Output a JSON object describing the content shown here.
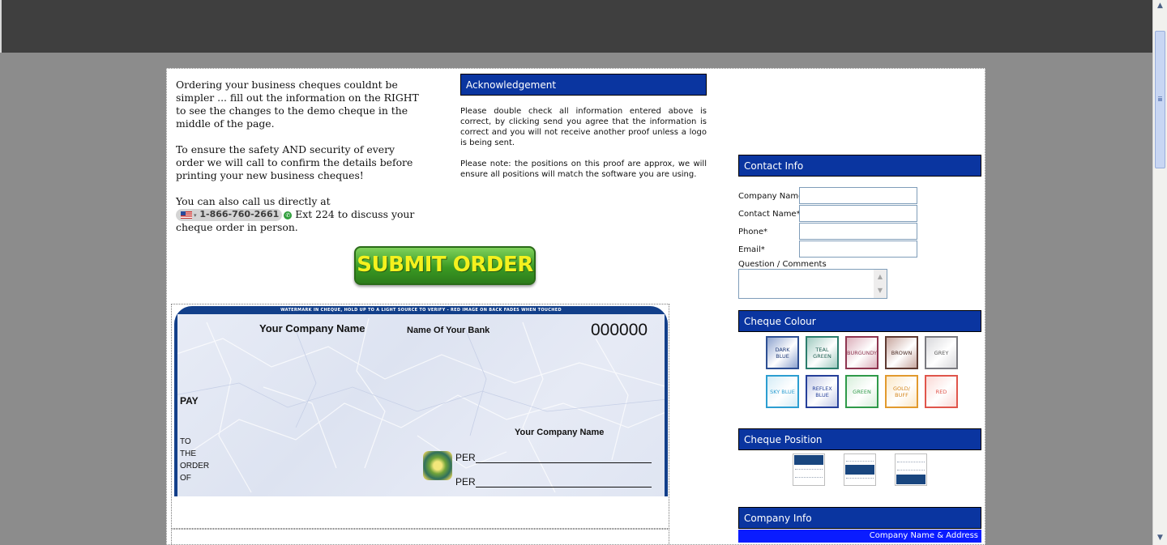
{
  "intro": {
    "para1": "Ordering your business cheques couldnt be simpler ... fill out the information on the RIGHT to see the changes to the demo cheque in the middle of the page.",
    "para2": "To ensure the safety AND security of every order we will call to confirm the details before printing your new business cheques!",
    "para3_prefix": "You can also call us directly at",
    "phone": "1-866-760-2661",
    "para3_suffix": "Ext 224 to discuss your cheque order in person."
  },
  "submit_label": "SUBMIT ORDER",
  "acknowledgement": {
    "title": "Acknowledgement",
    "text1": "Please double check all information entered above is correct, by clicking send you agree that the information is correct and you will not receive another proof unless a logo is being sent.",
    "text2": "Please note: the positions on this proof are approx, we will ensure all positions will match the software you are using."
  },
  "cheque": {
    "watermark": "WATERMARK IN CHEQUE, HOLD UP TO A LIGHT SOURCE TO VERIFY - RED IMAGE ON BACK FADES WHEN TOUCHED",
    "company_name": "Your Company Name",
    "bank_name": "Name Of Your Bank",
    "number": "000000",
    "pay": "PAY",
    "to": "TO",
    "the": "THE",
    "order": "ORDER",
    "of": "OF",
    "company_name_bottom": "Your Company Name",
    "per1": "PER",
    "per2": "PER"
  },
  "contact": {
    "title": "Contact Info",
    "company_label": "Company Name",
    "contact_label": "Contact Name*",
    "phone_label": "Phone*",
    "email_label": "Email*",
    "question_label": "Question / Comments",
    "company_value": "",
    "contact_value": "",
    "phone_value": "",
    "email_value": "",
    "question_value": ""
  },
  "colour": {
    "title": "Cheque Colour",
    "swatches": [
      {
        "label": "DARK BLUE",
        "color": "#8da3cf",
        "border": "#2d4f93",
        "text": "#1f3a78"
      },
      {
        "label": "TEAL GREEN",
        "color": "#9fcac0",
        "border": "#2b7d6c",
        "text": "#1a5c4e"
      },
      {
        "label": "BURGUNDY",
        "color": "#dcb0bb",
        "border": "#8e3550",
        "text": "#8e3550"
      },
      {
        "label": "BROWN",
        "color": "#c8a79f",
        "border": "#5e3a32",
        "text": "#4a2c25"
      },
      {
        "label": "GREY",
        "color": "#d9d9dc",
        "border": "#7a7a80",
        "text": "#555"
      },
      {
        "label": "SKY BLUE",
        "color": "#d4ecf6",
        "border": "#2c9ed1",
        "text": "#2c9ed1"
      },
      {
        "label": "REFLEX BLUE",
        "color": "#c2c9e6",
        "border": "#253f9a",
        "text": "#253f9a"
      },
      {
        "label": "GREEN",
        "color": "#d7efdb",
        "border": "#2f9a49",
        "text": "#2f9a49"
      },
      {
        "label": "GOLD/ BUFF",
        "color": "#fbe7c6",
        "border": "#e29a2e",
        "text": "#d4861a"
      },
      {
        "label": "RED",
        "color": "#fbd9d6",
        "border": "#e0554b",
        "text": "#e0554b"
      }
    ]
  },
  "position": {
    "title": "Cheque Position",
    "options": [
      "top",
      "middle",
      "bottom"
    ]
  },
  "company_info": {
    "title": "Company Info",
    "subheader": "Company Name & Address"
  }
}
